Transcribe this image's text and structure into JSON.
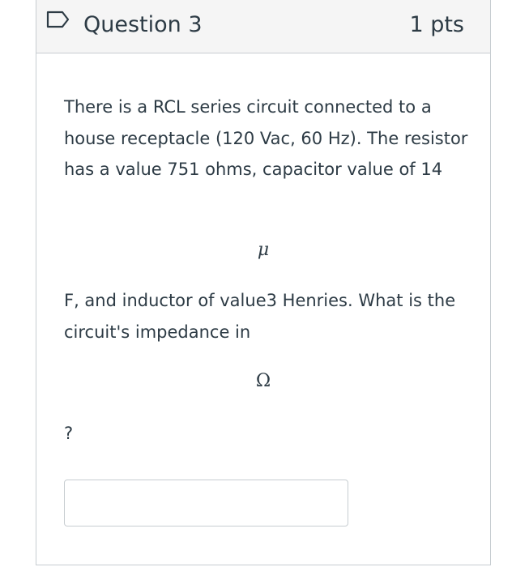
{
  "question": {
    "title": "Question 3",
    "points": "1 pts",
    "text_part1": "There is a RCL series circuit connected to a house receptacle (120 Vac, 60 Hz).  The resistor has a value 751 ohms, capacitor value of 14",
    "symbol_mu": "μ",
    "text_part2": "F, and inductor of value3 Henries.  What is the circuit's impedance in",
    "symbol_omega": "Ω",
    "text_part3": "?",
    "answer_value": ""
  },
  "icons": {
    "flag": "flag-outline-icon"
  },
  "colors": {
    "text": "#2d3b45",
    "header_bg": "#f5f5f5",
    "border": "#c7cdd1",
    "flag_stroke": "#2d3b45"
  }
}
